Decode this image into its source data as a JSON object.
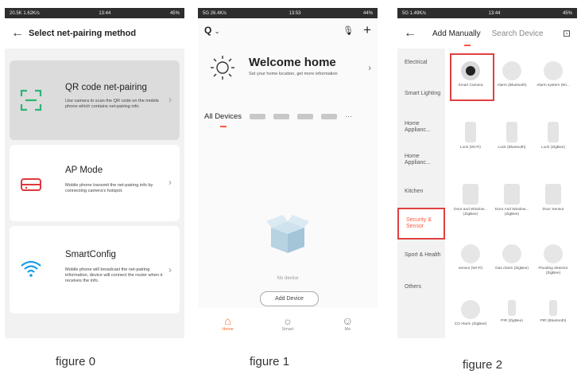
{
  "figure0": {
    "status": {
      "left": "20.5K 1.62K/s",
      "time": "13:44",
      "right": "45%"
    },
    "title": "Select net-pairing method",
    "options": [
      {
        "title": "QR code net-pairing",
        "desc": "Use camera to scan the QR code on the mobile phone which contains net-pairing info.",
        "icon": "qr-scan-icon"
      },
      {
        "title": "AP Mode",
        "desc": "Mobile phone transmit the net-pairing info by connecting camera's hotspot.",
        "icon": "router-icon"
      },
      {
        "title": "SmartConfig",
        "desc": "Mobile phone will broadcast the net-pairing information, device will connect the router when it receives the info.",
        "icon": "wifi-icon"
      }
    ],
    "caption": "figure 0"
  },
  "figure1": {
    "status": {
      "left": "5G 26.4K/s",
      "time": "13:53",
      "right": "44%"
    },
    "home_selector": "Q",
    "welcome_title": "Welcome home",
    "welcome_sub": "Set your home location, get more information",
    "tab_all": "All Devices",
    "more": "···",
    "no_device": "No device",
    "add_device": "Add Device",
    "nav": [
      {
        "label": "Home",
        "icon": "home-icon"
      },
      {
        "label": "Smart",
        "icon": "sun-icon"
      },
      {
        "label": "Me",
        "icon": "profile-icon"
      }
    ],
    "caption": "figure 1"
  },
  "figure2": {
    "status": {
      "left": "5G 1.49K/s",
      "time": "13:44",
      "right": "45%"
    },
    "tab_manual": "Add Manually",
    "tab_search": "Search Device",
    "categories": [
      "Electrical",
      "Smart Lighting",
      "Home Applianc...",
      "Home Applianc...",
      "Kitchen",
      "Security & Sensor",
      "Sport & Health",
      "Others"
    ],
    "active_category": "Security & Sensor",
    "devices": [
      "Smart Camera",
      "Alarm (Bluetooth)",
      "Alarm system (Wi...",
      "Lock (Wi-Fi)",
      "Lock (Bluetooth)",
      "Lock (ZigBee)",
      "Door and Window... (ZigBee)",
      "Door And Window... (ZigBee)",
      "Door Sensor",
      "sensor (Wi-Fi)",
      "Gas Alarm (ZigBee)",
      "Flooding detector (ZigBee)",
      "CO Alarm (ZigBee)",
      "PIR (ZigBee)",
      "PIR (Bluetooth)"
    ],
    "caption": "figure 2"
  },
  "colors": {
    "accent": "#ff5a3c",
    "highlight_box": "#e04040",
    "qr_green": "#2bb673",
    "ap_red": "#e0383e",
    "wifi_blue": "#1a9be8",
    "home_orange": "#ff6a2b"
  }
}
